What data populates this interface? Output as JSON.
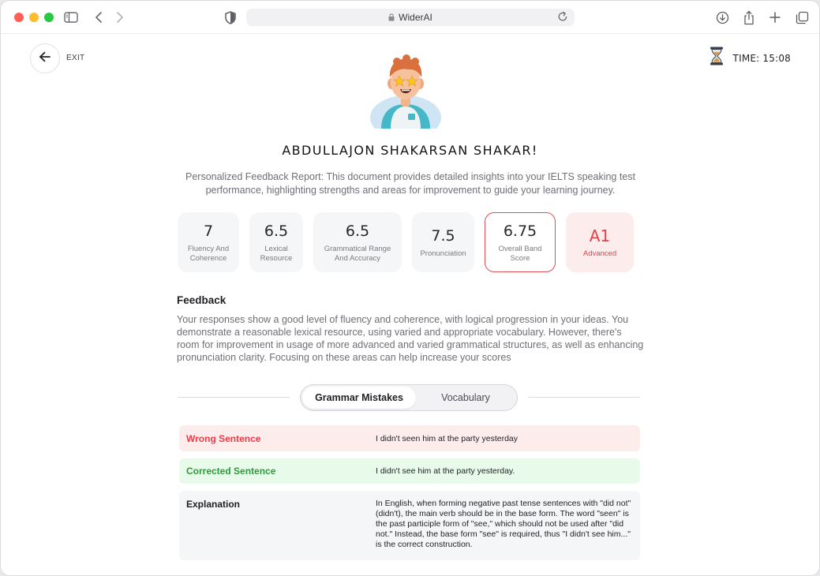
{
  "browser": {
    "url": "WiderAI"
  },
  "page": {
    "exit_label": "EXIT",
    "timer_label": "TIME: 15:08",
    "user_name": "ABDULLAJON SHAKARSAN SHAKAR!",
    "intro": "Personalized Feedback Report: This document provides detailed insights into your IELTS speaking test performance, highlighting strengths and areas for improvement to guide your learning journey.",
    "scores": [
      {
        "value": "7",
        "label": "Fluency And Coherence"
      },
      {
        "value": "6.5",
        "label": "Lexical Resource"
      },
      {
        "value": "6.5",
        "label": "Grammatical Range And Accuracy"
      },
      {
        "value": "7.5",
        "label": "Pronunciation"
      },
      {
        "value": "6.75",
        "label": "Overall Band Score"
      },
      {
        "value": "A1",
        "label": "Advanced"
      }
    ],
    "feedback": {
      "title": "Feedback",
      "text": "Your responses show a good level of fluency and coherence, with logical progression in your ideas. You demonstrate a reasonable lexical resource, using varied and appropriate vocabulary. However, there's room for improvement in usage of more advanced and varied grammatical structures, as well as enhancing pronunciation clarity. Focusing on these areas can help increase your scores"
    },
    "tabs": [
      {
        "label": "Grammar Mistakes",
        "active": true
      },
      {
        "label": "Vocabulary",
        "active": false
      }
    ],
    "mistakes": {
      "wrong_label": "Wrong Sentence",
      "wrong_text": "I didn't seen him at the party yesterday",
      "corrected_label": "Corrected Sentence",
      "corrected_text": "I didn't see him at the party yesterday.",
      "explanation_label": "Explanation",
      "explanation_text": "In English, when forming negative past tense sentences with \"did not\" (didn't), the main verb should be in the base form. The word \"seen\" is the past participle form of \"see,\" which should not be used after \"did not.\" Instead, the base form \"see\" is required, thus \"I didn't see him...\" is the correct construction."
    }
  },
  "colors": {
    "accent_red": "#ea3d47",
    "accent_green": "#2a9b3a",
    "wrong_bg": "#fdecec",
    "correct_bg": "#e8fbea"
  },
  "icons": {
    "sidebar": "sidebar-icon",
    "back": "chevron-left-icon",
    "forward": "chevron-right-icon",
    "shield": "shield-icon",
    "lock": "lock-icon",
    "reload": "reload-icon",
    "download": "download-icon",
    "share": "share-icon",
    "new_tab": "plus-icon",
    "tabs": "tabs-overview-icon",
    "exit": "arrow-left-icon",
    "timer": "hourglass-icon"
  }
}
